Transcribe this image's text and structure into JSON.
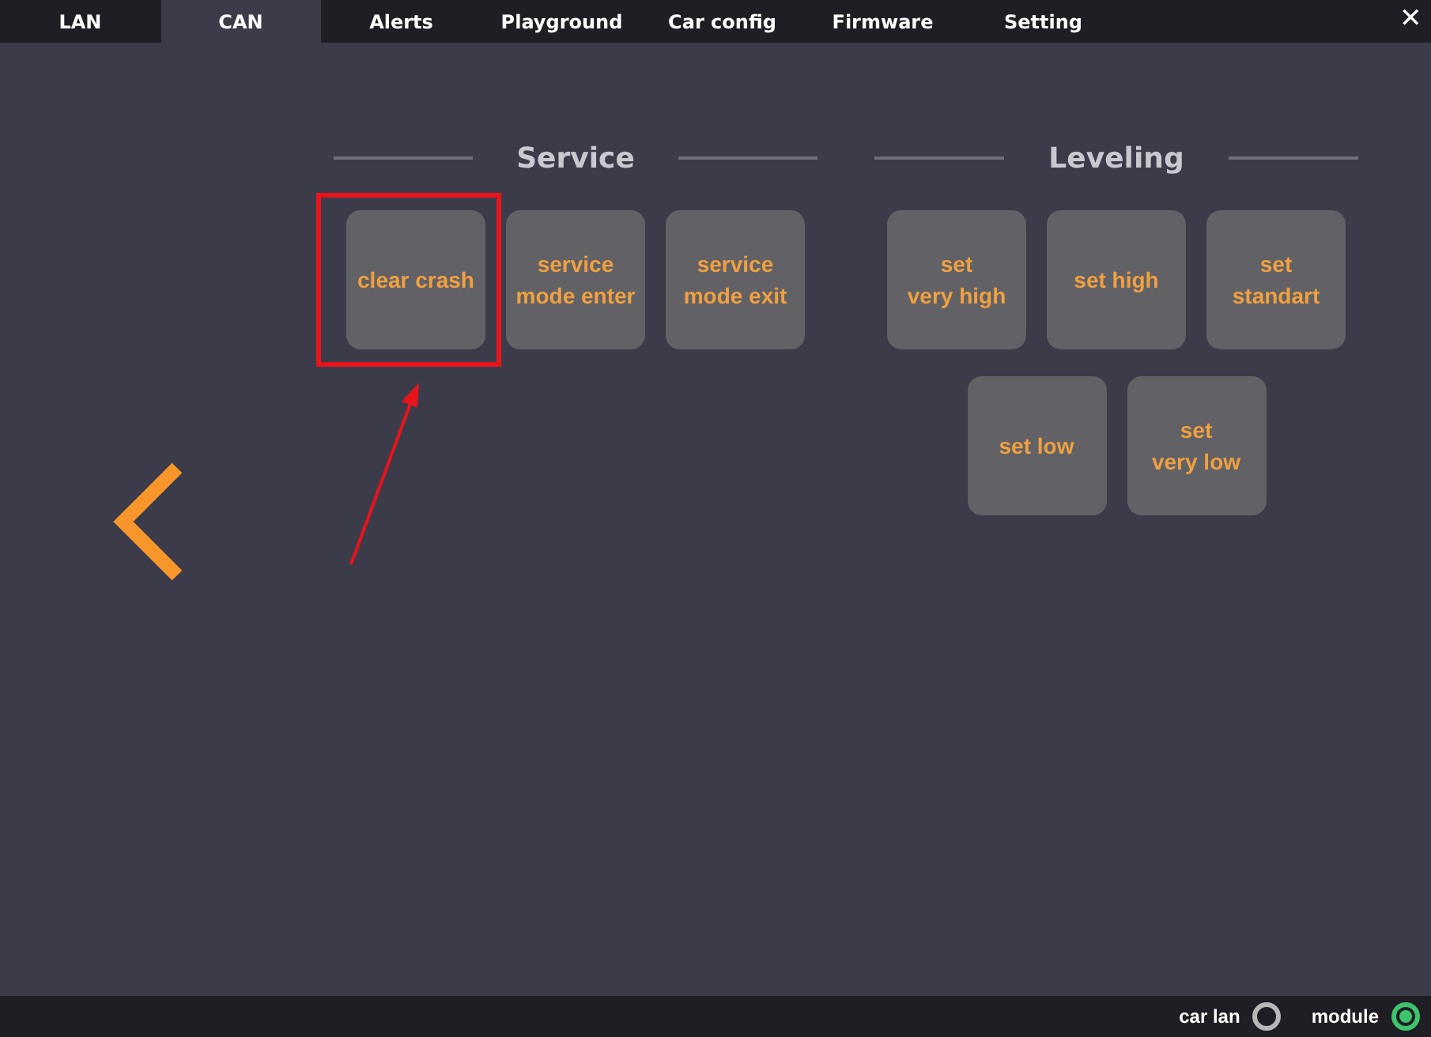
{
  "tabs": [
    {
      "label": "LAN",
      "selected": false
    },
    {
      "label": "CAN",
      "selected": true
    },
    {
      "label": "Alerts",
      "selected": false
    },
    {
      "label": "Playground",
      "selected": false
    },
    {
      "label": "Car config",
      "selected": false
    },
    {
      "label": "Firmware",
      "selected": false
    },
    {
      "label": "Setting",
      "selected": false
    }
  ],
  "close": "✕",
  "sections": [
    {
      "title": "Service",
      "rows": [
        [
          {
            "lines": [
              "clear crash"
            ],
            "highlighted": true
          },
          {
            "lines": [
              "service",
              "mode enter"
            ],
            "highlighted": false
          },
          {
            "lines": [
              "service",
              "mode exit"
            ],
            "highlighted": false
          }
        ]
      ]
    },
    {
      "title": "Leveling",
      "rows": [
        [
          {
            "lines": [
              "set",
              "very high"
            ],
            "highlighted": false
          },
          {
            "lines": [
              "set high"
            ],
            "highlighted": false
          },
          {
            "lines": [
              "set",
              "standart"
            ],
            "highlighted": false
          }
        ],
        [
          {
            "lines": [
              "set low"
            ],
            "highlighted": false
          },
          {
            "lines": [
              "set",
              "very low"
            ],
            "highlighted": false
          }
        ]
      ]
    }
  ],
  "status": [
    {
      "label": "car lan",
      "on": false
    },
    {
      "label": "module",
      "on": true
    }
  ]
}
